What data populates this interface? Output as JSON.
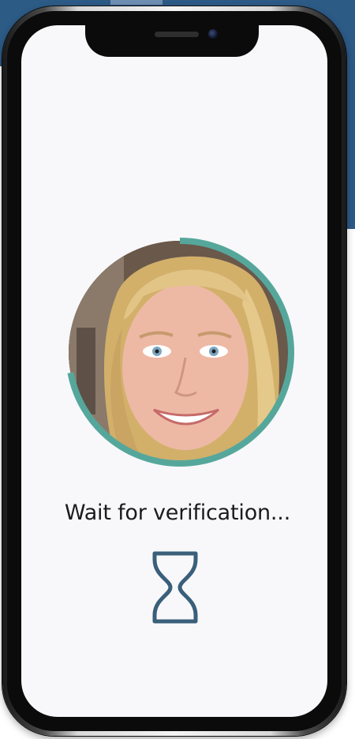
{
  "screen": {
    "status_text": "Wait for verification...",
    "progress_fraction": 0.72,
    "accent_color": "#56a79b",
    "icon": "hourglass-icon",
    "icon_color": "#3a5f7a"
  }
}
